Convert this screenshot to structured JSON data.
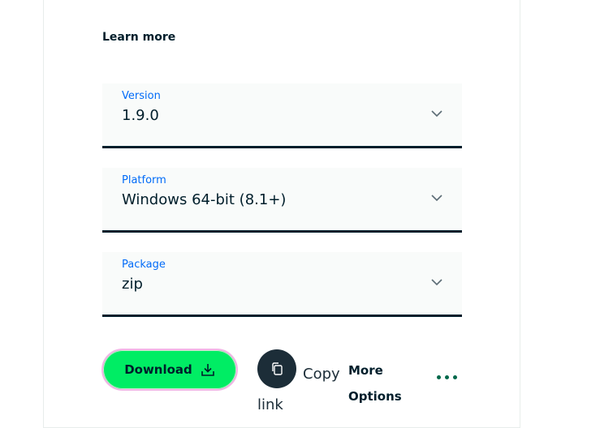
{
  "learn_more": "Learn more",
  "selects": [
    {
      "label": "Version",
      "value": "1.9.0"
    },
    {
      "label": "Platform",
      "value": "Windows 64-bit (8.1+)"
    },
    {
      "label": "Package",
      "value": "zip"
    }
  ],
  "actions": {
    "download_label": "Download",
    "copy_link_label": "Copy link",
    "more_options_label": "More Options"
  },
  "icons": {
    "dropdown": "chevron-down-icon",
    "download": "download-icon",
    "copy": "copy-icon",
    "more": "ellipsis-icon"
  },
  "colors": {
    "accent_green": "#00ed64",
    "label_blue": "#016bf8",
    "text_dark": "#001e2b",
    "dots_green": "#00684a"
  }
}
